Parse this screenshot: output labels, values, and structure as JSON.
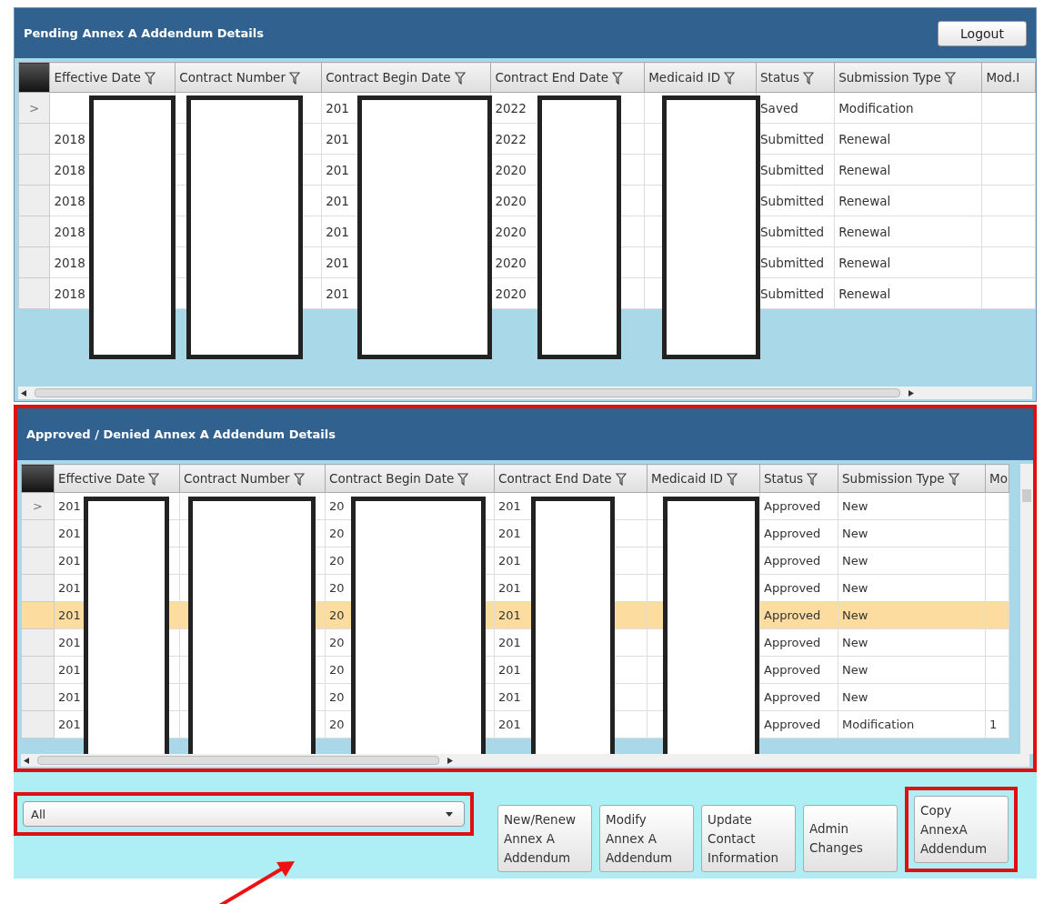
{
  "pending": {
    "title": "Pending Annex A Addendum Details",
    "logout": "Logout",
    "columns": [
      "Effective Date",
      "Contract Number",
      "Contract Begin Date",
      "Contract End Date",
      "Medicaid ID",
      "Status",
      "Submission Type",
      "Mod.I"
    ],
    "rows": [
      {
        "marker": ">",
        "contract_begin_date": "201",
        "contract_end_date": "2022",
        "status": "Saved",
        "submission_type": "Modification"
      },
      {
        "effective_date": "2018",
        "contract_begin_date": "201",
        "contract_end_date": "2022",
        "status": "Submitted",
        "submission_type": "Renewal"
      },
      {
        "effective_date": "2018",
        "contract_begin_date": "201",
        "contract_end_date": "2020",
        "status": "Submitted",
        "submission_type": "Renewal"
      },
      {
        "effective_date": "2018",
        "contract_begin_date": "201",
        "contract_end_date": "2020",
        "status": "Submitted",
        "submission_type": "Renewal"
      },
      {
        "effective_date": "2018",
        "contract_begin_date": "201",
        "contract_end_date": "2020",
        "status": "Submitted",
        "submission_type": "Renewal"
      },
      {
        "effective_date": "2018",
        "contract_begin_date": "201",
        "contract_end_date": "2020",
        "status": "Submitted",
        "submission_type": "Renewal"
      },
      {
        "effective_date": "2018",
        "contract_begin_date": "201",
        "contract_end_date": "2020",
        "status": "Submitted",
        "submission_type": "Renewal"
      }
    ]
  },
  "approved": {
    "title": "Approved / Denied Annex A Addendum Details",
    "columns": [
      "Effective Date",
      "Contract Number",
      "Contract Begin Date",
      "Contract End Date",
      "Medicaid ID",
      "Status",
      "Submission Type",
      "Mo"
    ],
    "rows": [
      {
        "marker": ">",
        "selected": false,
        "effective_date": "201",
        "contract_begin_date": "20",
        "contract_end_date": "201",
        "status": "Approved",
        "submission_type": "New"
      },
      {
        "selected": false,
        "effective_date": "201",
        "contract_begin_date": "20",
        "contract_end_date": "201",
        "status": "Approved",
        "submission_type": "New"
      },
      {
        "selected": false,
        "effective_date": "201",
        "contract_begin_date": "20",
        "contract_end_date": "201",
        "status": "Approved",
        "submission_type": "New"
      },
      {
        "selected": false,
        "effective_date": "201",
        "contract_begin_date": "20",
        "contract_end_date": "201",
        "status": "Approved",
        "submission_type": "New"
      },
      {
        "selected": true,
        "effective_date": "201",
        "contract_begin_date": "20",
        "contract_end_date": "201",
        "status": "Approved",
        "submission_type": "New"
      },
      {
        "selected": false,
        "effective_date": "201",
        "contract_begin_date": "20",
        "contract_end_date": "201",
        "status": "Approved",
        "submission_type": "New"
      },
      {
        "selected": false,
        "effective_date": "201",
        "contract_begin_date": "20",
        "contract_end_date": "201",
        "status": "Approved",
        "submission_type": "New"
      },
      {
        "selected": false,
        "effective_date": "201",
        "contract_begin_date": "20",
        "contract_end_date": "201",
        "status": "Approved",
        "submission_type": "New"
      },
      {
        "selected": false,
        "effective_date": "201",
        "contract_begin_date": "20",
        "contract_end_date": "201",
        "status": "Approved",
        "submission_type": "Modification",
        "mod": "1"
      }
    ]
  },
  "filter": {
    "value": "All"
  },
  "buttons": [
    {
      "label": "New/Renew\nAnnex A\nAddendum",
      "highlighted": false
    },
    {
      "label": "Modify\nAnnex A\nAddendum",
      "highlighted": false
    },
    {
      "label": "Update\nContact\nInformation",
      "highlighted": false
    },
    {
      "label": "Admin\nChanges",
      "highlighted": false
    },
    {
      "label": "Copy\nAnnexA\nAddendum",
      "highlighted": true
    }
  ]
}
